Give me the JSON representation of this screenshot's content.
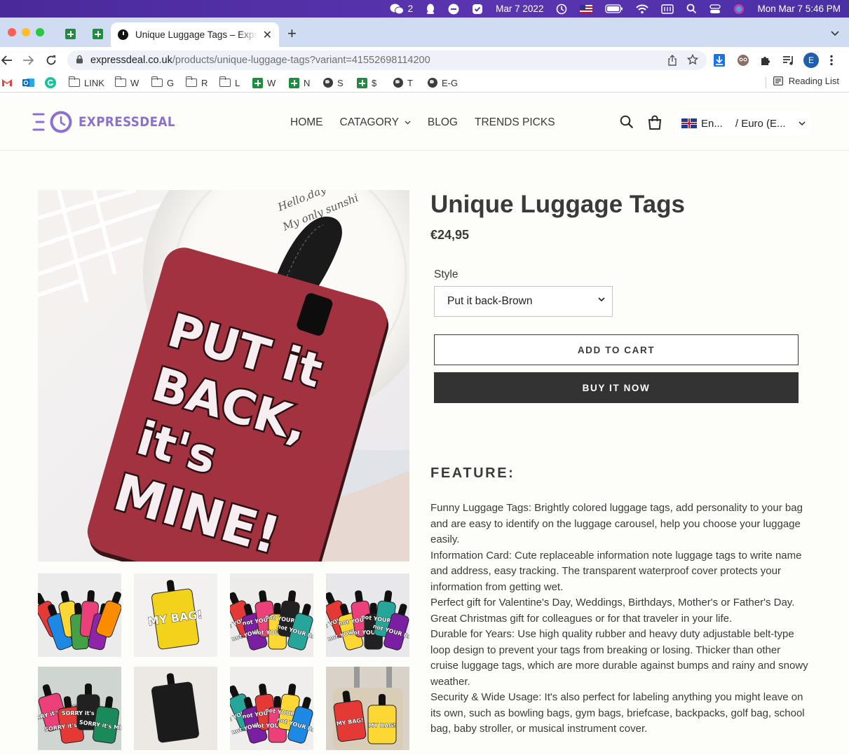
{
  "menubar": {
    "wechat_count": "2",
    "date": "Mar 7 2022",
    "clock": "Mon Mar 7  5:46 PM"
  },
  "browser": {
    "tab_title": "Unique Luggage Tags – Expres",
    "url_host": "expressdeal.co.uk",
    "url_path": "/products/unique-luggage-tags?variant=41552698114200",
    "profile_initial": "E"
  },
  "bookmarks": {
    "items": [
      "LINK",
      "W",
      "G",
      "R",
      "L",
      "W",
      "N",
      "S",
      "$",
      "T",
      "E-G"
    ],
    "reading_list": "Reading List"
  },
  "site": {
    "logo": "EXPRESSDEAL",
    "nav": [
      "HOME",
      "CATAGORY",
      "BLOG",
      "TRENDS PICKS"
    ],
    "language": "En...",
    "currency": "/ Euro (E..."
  },
  "product": {
    "title": "Unique Luggage Tags",
    "price": "€24,95",
    "style_label": "Style",
    "style_value": "Put it back-Brown",
    "add_to_cart": "ADD TO CART",
    "buy_now": "BUY IT NOW",
    "image_text": [
      "PUT it",
      "BACK,",
      "it's",
      "MINE!"
    ],
    "image_mug_text": "Hello,day My only sunshi",
    "feature_heading": "FEATURE:",
    "description": [
      "Funny Luggage Tags: Brightly colored luggage tags, add personality to your bag and are easy to identify on the luggage carousel, help you choose your luggage easily.",
      "Information Card: Cute replaceable information note luggage tags to write name and address, easy tracking. The transparent waterproof cover protects your information from getting wet.",
      "Perfect gift for Valentine's Day, Weddings, Birthdays, Mother's or Father's Day. Great Christmas gift for colleagues or for that traveler in your life.",
      "Durable for Years: Use high quality rubber and heavy duty adjustable belt-type loop design to prevent your tags from breaking or losing. Thicker than other cruise luggage tags, which are more durable against bumps and rainy and snowy weather.",
      "Security & Wide Usage: It's also perfect for labeling anything you might leave on its own, such as bowling bags, gym bags, briefcase, backpacks, golf bag, school bag, baby stroller, or musical instrument cover."
    ]
  },
  "thumbnails": [
    {
      "text": "",
      "colors": [
        "#e53935",
        "#1e88e5",
        "#fdd835",
        "#43a047",
        "#ec407a",
        "#8e24aa",
        "#fb8c00"
      ]
    },
    {
      "text": "MY BAG!",
      "colors": [
        "#f2d21b"
      ]
    },
    {
      "text": "not YOUR BAG!",
      "colors": [
        "#e53935",
        "#7b1fa2",
        "#ec407a",
        "#fdd835",
        "#212121",
        "#26a69a"
      ]
    },
    {
      "text": "not YOUR BAG!",
      "colors": [
        "#e53935",
        "#fdd835",
        "#ec407a",
        "#212121",
        "#26a69a",
        "#7b1fa2"
      ]
    },
    {
      "text": "SORRY it's MINE!",
      "colors": [
        "#ec407a",
        "#e53935",
        "#212121",
        "#1b8a5a"
      ]
    },
    {
      "text": "",
      "colors": [
        "#1b1b1b"
      ]
    },
    {
      "text": "not YOUR BAG!",
      "colors": [
        "#26a69a",
        "#7b1fa2",
        "#e53935",
        "#ec407a",
        "#fdd835",
        "#1e88e5"
      ]
    },
    {
      "text": "MY BAG!",
      "colors": [
        "#e53935",
        "#fdd835"
      ]
    }
  ],
  "colors": {
    "accent": "#8b6fd2",
    "tag_red": "#a2323f",
    "button_dark": "#333333"
  }
}
